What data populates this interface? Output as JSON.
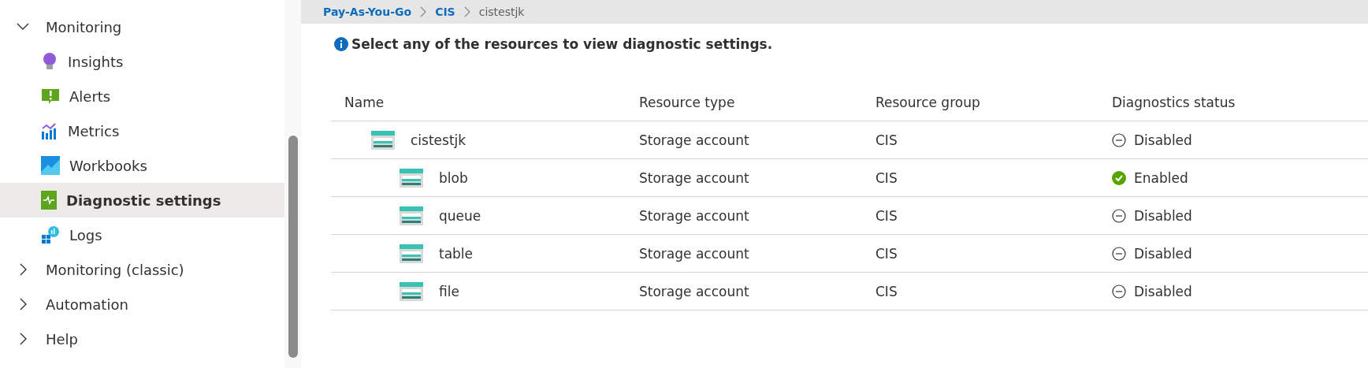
{
  "sidebar": {
    "groups": [
      {
        "label": "Monitoring",
        "expanded": true,
        "items": [
          {
            "label": "Insights",
            "kind": "insights",
            "selected": false
          },
          {
            "label": "Alerts",
            "kind": "alerts",
            "selected": false
          },
          {
            "label": "Metrics",
            "kind": "metrics",
            "selected": false
          },
          {
            "label": "Workbooks",
            "kind": "workbooks",
            "selected": false
          },
          {
            "label": "Diagnostic settings",
            "kind": "diagnostic",
            "selected": true
          },
          {
            "label": "Logs",
            "kind": "logs",
            "selected": false
          }
        ]
      },
      {
        "label": "Monitoring (classic)",
        "expanded": false
      },
      {
        "label": "Automation",
        "expanded": false
      },
      {
        "label": "Help",
        "expanded": false
      }
    ]
  },
  "breadcrumb": [
    {
      "label": "Pay-As-You-Go",
      "link": true
    },
    {
      "label": "CIS",
      "link": true
    },
    {
      "label": "cistestjk",
      "link": false
    }
  ],
  "info": "Select any of the resources to view diagnostic settings.",
  "table": {
    "columns": [
      "Name",
      "Resource type",
      "Resource group",
      "Diagnostics status"
    ],
    "rows": [
      {
        "name": "cistestjk",
        "type": "Storage account",
        "group": "CIS",
        "status": "Disabled",
        "enabled": false,
        "children": [
          {
            "name": "blob",
            "type": "Storage account",
            "group": "CIS",
            "status": "Enabled",
            "enabled": true
          },
          {
            "name": "queue",
            "type": "Storage account",
            "group": "CIS",
            "status": "Disabled",
            "enabled": false
          },
          {
            "name": "table",
            "type": "Storage account",
            "group": "CIS",
            "status": "Disabled",
            "enabled": false
          },
          {
            "name": "file",
            "type": "Storage account",
            "group": "CIS",
            "status": "Disabled",
            "enabled": false
          }
        ]
      }
    ]
  }
}
